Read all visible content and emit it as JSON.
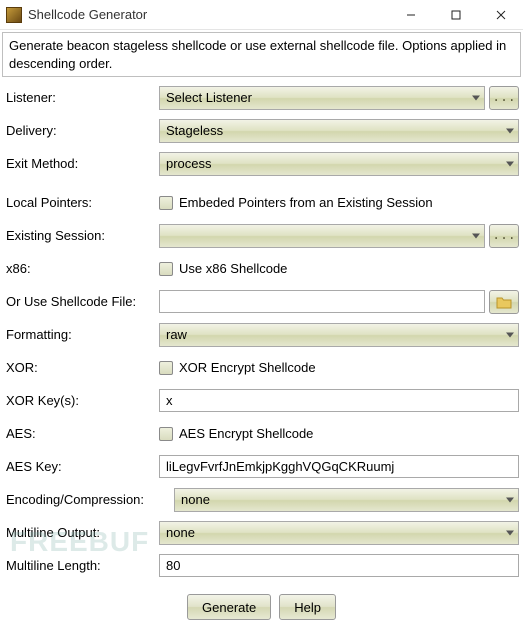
{
  "window": {
    "title": "Shellcode Generator",
    "minimize": "Minimize",
    "maximize": "Maximize",
    "close": "Close"
  },
  "description": "Generate beacon stageless shellcode or use external shellcode file. Options applied in descending order.",
  "labels": {
    "listener": "Listener:",
    "delivery": "Delivery:",
    "exit_method": "Exit Method:",
    "local_pointers": "Local Pointers:",
    "existing_session": "Existing Session:",
    "x86": "x86:",
    "or_shellcode_file": "Or Use Shellcode File:",
    "formatting": "Formatting:",
    "xor": "XOR:",
    "xor_keys": "XOR Key(s):",
    "aes": "AES:",
    "aes_key": "AES Key:",
    "encoding": "Encoding/Compression:",
    "multiline_output": "Multiline Output:",
    "multiline_length": "Multiline Length:"
  },
  "values": {
    "listener": "Select Listener",
    "delivery": "Stageless",
    "exit_method": "process",
    "local_pointers_text": "Embeded Pointers from an Existing Session",
    "existing_session": "",
    "x86_text": "Use x86 Shellcode",
    "shellcode_file": "",
    "formatting": "raw",
    "xor_text": "XOR Encrypt Shellcode",
    "xor_keys": "x",
    "aes_text": "AES Encrypt Shellcode",
    "aes_key": "liLegvFvrfJnEmkjpKgghVQGqCKRuumj",
    "encoding": "none",
    "multiline_output": "none",
    "multiline_length": "80"
  },
  "buttons": {
    "generate": "Generate",
    "help": "Help",
    "browse_ellipsis": "..."
  },
  "watermark": "FREEBUF"
}
